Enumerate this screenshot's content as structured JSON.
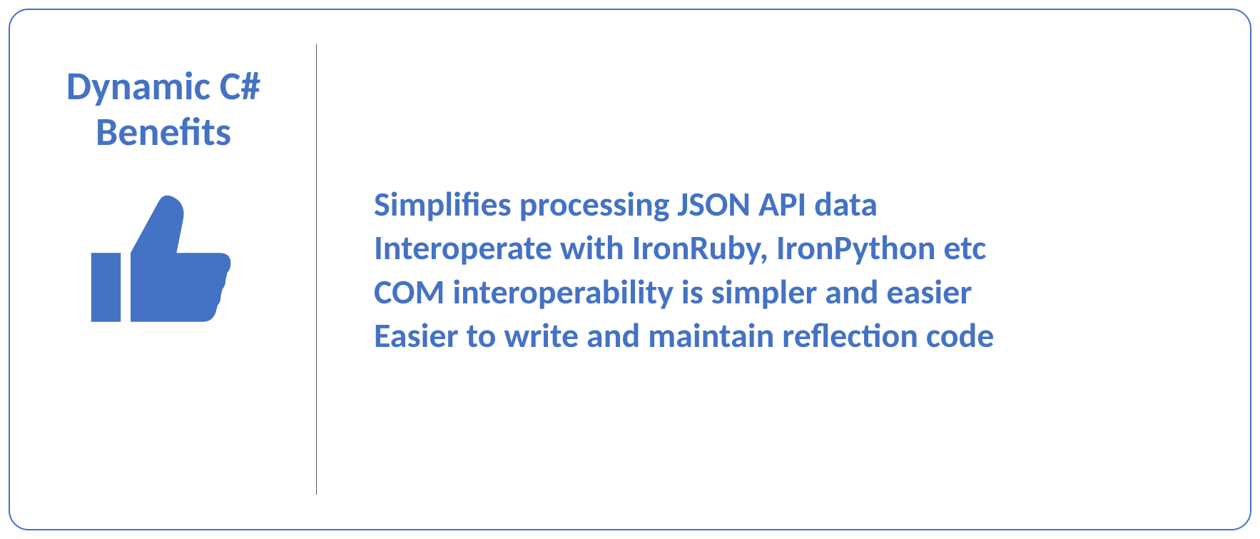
{
  "title_line1": "Dynamic C#",
  "title_line2": "Benefits",
  "icon_name": "thumbs-up-icon",
  "accent_color": "#4472C4",
  "benefits": [
    "Simplifies processing JSON API data",
    "Interoperate with IronRuby, IronPython etc",
    "COM interoperability is simpler and easier",
    "Easier to write and maintain reflection code"
  ]
}
